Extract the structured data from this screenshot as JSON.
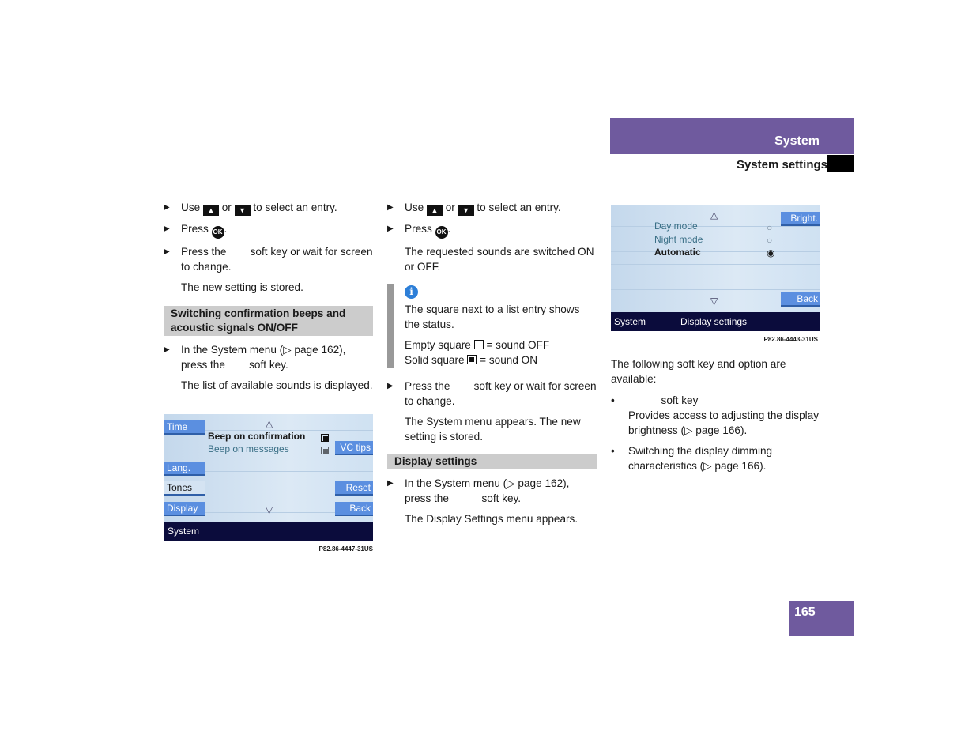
{
  "header": {
    "section": "System",
    "subsection": "System settings"
  },
  "page_number": "165",
  "col1": {
    "b1": {
      "pre": "Use",
      "up": "▲",
      "or": "or",
      "down": "▼",
      "post": "to select an entry."
    },
    "b2": {
      "pre": "Press",
      "ok": "OK",
      "post": "."
    },
    "b3": "Press the        soft key or wait for screen to change.",
    "p1": "The new setting is stored.",
    "section": "Switching confirmation beeps and acoustic signals ON/OFF",
    "b4": "In the System menu (▷ page 162), press the        soft key.",
    "p2": "The list of available sounds is displayed.",
    "screen": {
      "left_buttons": [
        "Time",
        "Lang.",
        "Tones",
        "Display"
      ],
      "right_buttons": [
        "VC tips",
        "Reset",
        "Back"
      ],
      "items": [
        "Beep on confirmation",
        "Beep on messages"
      ],
      "bar": "System",
      "caption": "P82.86-4447-31US"
    }
  },
  "col2": {
    "b1": {
      "pre": "Use",
      "up": "▲",
      "or": "or",
      "down": "▼",
      "post": "to select an entry."
    },
    "b2": {
      "pre": "Press",
      "ok": "OK",
      "post": "."
    },
    "p1": "The requested sounds are switched ON or OFF.",
    "info": {
      "icon": "info-icon",
      "t1": "The square next to a list entry shows the status.",
      "empty": "Empty square",
      "empty_post": "= sound OFF",
      "solid": "Solid square",
      "solid_post": "= sound ON"
    },
    "b3": "Press the        soft key or wait for screen to change.",
    "p2": "The System menu appears. The new setting is stored.",
    "section": "Display settings",
    "b4": "In the System menu (▷ page 162), press the           soft key.",
    "p3": "The Display Settings menu appears."
  },
  "col3": {
    "screen": {
      "items": [
        "Day mode",
        "Night mode",
        "Automatic"
      ],
      "selected": "Automatic",
      "right_buttons": [
        "Bright.",
        "Back"
      ],
      "bar_left": "System",
      "bar_right": "Display settings",
      "caption": "P82.86-4443-31US"
    },
    "p1": "The following soft key and option are available:",
    "li1a": "           soft key",
    "li1b": "Provides access to adjusting the display brightness (▷ page 166).",
    "li2": "Switching the display dimming characteristics (▷ page 166)."
  },
  "colors": {
    "accent": "#6f5a9e",
    "screen_button": "#5b8fe0",
    "screen_bar": "#0b0c3c",
    "info": "#2d7fd8"
  }
}
